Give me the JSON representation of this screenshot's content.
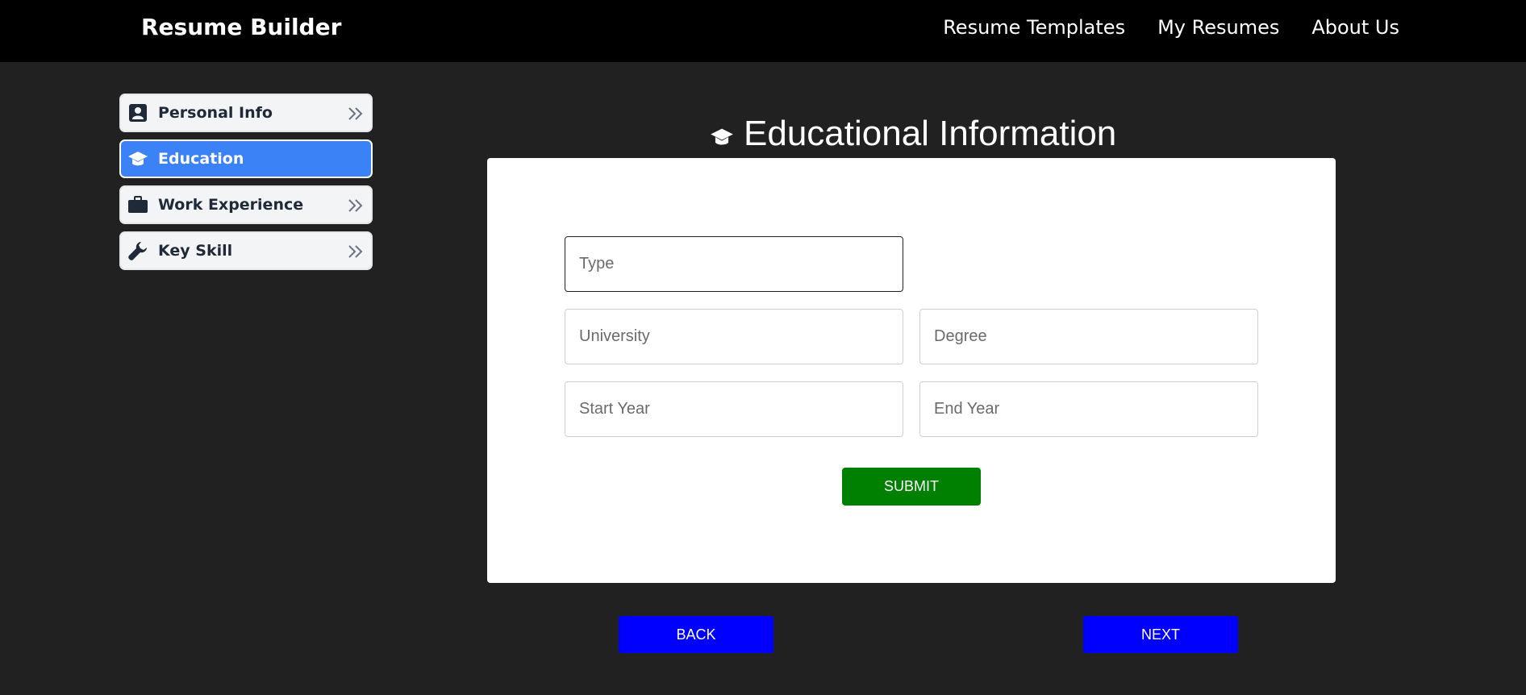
{
  "header": {
    "brand": "Resume Builder",
    "links": [
      "Resume Templates",
      "My Resumes",
      "About Us"
    ]
  },
  "sidebar": {
    "items": [
      {
        "label": "Personal Info",
        "icon": "id-card-icon",
        "active": false
      },
      {
        "label": "Education",
        "icon": "graduation-cap-icon",
        "active": true
      },
      {
        "label": "Work Experience",
        "icon": "briefcase-icon",
        "active": false
      },
      {
        "label": "Key Skill",
        "icon": "wrench-icon",
        "active": false
      }
    ]
  },
  "main": {
    "title": "Educational Information",
    "title_icon": "graduation-cap-icon",
    "form": {
      "type_placeholder": "Type",
      "university_placeholder": "University",
      "degree_placeholder": "Degree",
      "start_year_placeholder": "Start Year",
      "end_year_placeholder": "End Year",
      "submit_label": "SUBMIT"
    },
    "back_label": "BACK",
    "next_label": "NEXT"
  },
  "colors": {
    "navbar": "#000000",
    "background": "#212121",
    "active_tab": "#3b82f6",
    "submit": "#008000",
    "nav_buttons": "#0000ff"
  }
}
